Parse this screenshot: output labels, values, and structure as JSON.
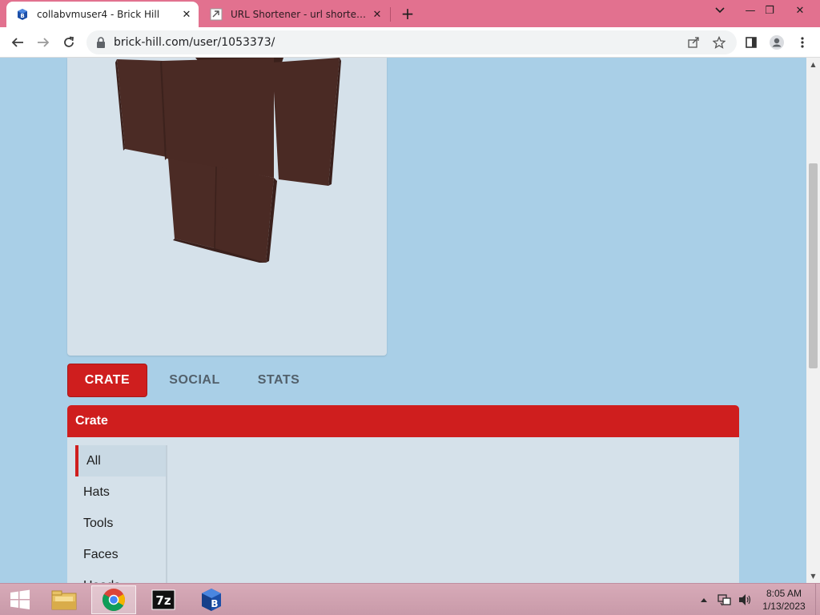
{
  "browser": {
    "tabs": [
      {
        "title": "collabvmuser4 - Brick Hill",
        "active": true,
        "favicon": "brick-hill-icon"
      },
      {
        "title": "URL Shortener - url shortening s",
        "active": false,
        "favicon": "link-icon"
      }
    ],
    "new_tab_label": "+",
    "window_controls": {
      "dropdown": "⌄",
      "minimize": "—",
      "restore": "❐",
      "close": "✕"
    },
    "url": "brick-hill.com/user/1053373/"
  },
  "profile": {
    "tabs": [
      {
        "label": "CRATE",
        "active": true
      },
      {
        "label": "SOCIAL",
        "active": false
      },
      {
        "label": "STATS",
        "active": false
      }
    ],
    "crate": {
      "title": "Crate",
      "categories": [
        {
          "label": "All",
          "active": true
        },
        {
          "label": "Hats",
          "active": false
        },
        {
          "label": "Tools",
          "active": false
        },
        {
          "label": "Faces",
          "active": false
        },
        {
          "label": "Heads",
          "active": false
        }
      ]
    }
  },
  "taskbar": {
    "apps": [
      "file-explorer",
      "chrome",
      "7-zip",
      "brick-hill"
    ],
    "time": "8:05 AM",
    "date": "1/13/2023"
  },
  "colors": {
    "page_background": "#a9cfe7",
    "accent_red": "#cf1e1e",
    "card_background": "#d5e1ea",
    "tab_strip": "#e2718f",
    "avatar_brown": "#4a2a24"
  }
}
